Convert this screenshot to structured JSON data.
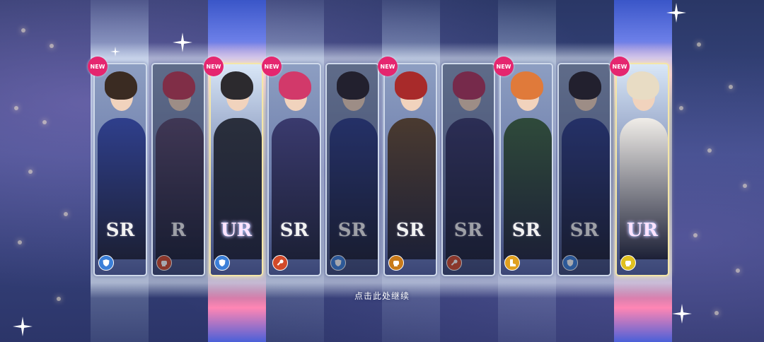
{
  "screen": "gacha-results",
  "colors": {
    "new_badge": "#e5266f",
    "attr_defense": "#3b7fd8",
    "attr_fire": "#d24a2a",
    "attr_strength": "#e0a020"
  },
  "cards": [
    {
      "rarity": "SR",
      "new": true,
      "new_label": "NEW",
      "attribute": "shield-icon",
      "attr_color": "#3b7fd8",
      "hair": "#3a2b22",
      "outfit": "#2f3f8c",
      "dim": false
    },
    {
      "rarity": "R",
      "new": false,
      "new_label": "",
      "attribute": "fist-icon",
      "attr_color": "#d24a2a",
      "hair": "#c23a57",
      "outfit": "#5b4a6e",
      "dim": true
    },
    {
      "rarity": "UR",
      "new": true,
      "new_label": "NEW",
      "attribute": "shield-icon",
      "attr_color": "#3b7fd8",
      "hair": "#2c2a2e",
      "outfit": "#2a2f3c",
      "dim": false
    },
    {
      "rarity": "SR",
      "new": true,
      "new_label": "NEW",
      "attribute": "wrench-icon",
      "attr_color": "#d24a2a",
      "hair": "#d2396a",
      "outfit": "#3a3a6e",
      "dim": false
    },
    {
      "rarity": "SR",
      "new": false,
      "new_label": "",
      "attribute": "shield-icon",
      "attr_color": "#3b7fd8",
      "hair": "#2a2530",
      "outfit": "#2f3f8c",
      "dim": true
    },
    {
      "rarity": "SR",
      "new": true,
      "new_label": "NEW",
      "attribute": "fist-icon",
      "attr_color": "#c87a1a",
      "hair": "#a82a2a",
      "outfit": "#4a3a30",
      "dim": false
    },
    {
      "rarity": "SR",
      "new": false,
      "new_label": "",
      "attribute": "wrench-icon",
      "attr_color": "#d24a2a",
      "hair": "#b2345e",
      "outfit": "#3a3a6e",
      "dim": true
    },
    {
      "rarity": "SR",
      "new": true,
      "new_label": "NEW",
      "attribute": "boot-icon",
      "attr_color": "#e0a020",
      "hair": "#e07a3a",
      "outfit": "#2f4a3a",
      "dim": false
    },
    {
      "rarity": "SR",
      "new": false,
      "new_label": "",
      "attribute": "shield-icon",
      "attr_color": "#3b7fd8",
      "hair": "#2a2530",
      "outfit": "#2f3f8c",
      "dim": true
    },
    {
      "rarity": "UR",
      "new": true,
      "new_label": "NEW",
      "attribute": "fist-icon",
      "attr_color": "#e0c020",
      "hair": "#e8dcc4",
      "outfit": "#f0ede8",
      "dim": false
    }
  ],
  "footer": {
    "continue_label": "点击此处继续"
  }
}
